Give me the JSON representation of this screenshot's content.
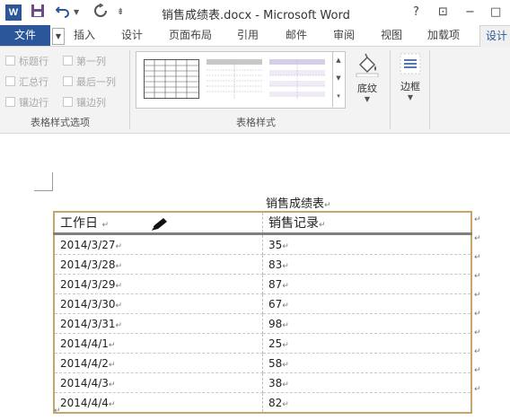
{
  "window": {
    "title": "销售成绩表.docx - Microsoft Word",
    "app_logo": "W",
    "help": "?",
    "restore": "⊡",
    "minimize": "−",
    "maximize": "□"
  },
  "quick_access": {
    "save_icon": "save-icon",
    "undo_icon": "undo-icon",
    "redo_icon": "redo-icon",
    "customize_icon": "customize-icon"
  },
  "tabs": {
    "file": "文件",
    "items": [
      "插入",
      "设计",
      "页面布局",
      "引用",
      "邮件",
      "审阅",
      "视图",
      "加载项",
      "设计"
    ],
    "active_index": 8
  },
  "ribbon": {
    "table_style_options": {
      "label": "表格样式选项",
      "options": [
        "标题行",
        "第一列",
        "汇总行",
        "最后一列",
        "镶边行",
        "镶边列"
      ]
    },
    "table_styles": {
      "label": "表格样式"
    },
    "shading": {
      "label": "底纹"
    },
    "borders": {
      "label": "边框"
    }
  },
  "document": {
    "title": "销售成绩表",
    "headers": [
      "工作日",
      "销售记录"
    ],
    "rows": [
      [
        "2014/3/27",
        "35"
      ],
      [
        "2014/3/28",
        "83"
      ],
      [
        "2014/3/29",
        "87"
      ],
      [
        "2014/3/30",
        "67"
      ],
      [
        "2014/3/31",
        "98"
      ],
      [
        "2014/4/1",
        "25"
      ],
      [
        "2014/4/2",
        "58"
      ],
      [
        "2014/4/3",
        "38"
      ],
      [
        "2014/4/4",
        "82"
      ]
    ],
    "para_mark": "↵",
    "accent_border": "#c9a46a"
  }
}
